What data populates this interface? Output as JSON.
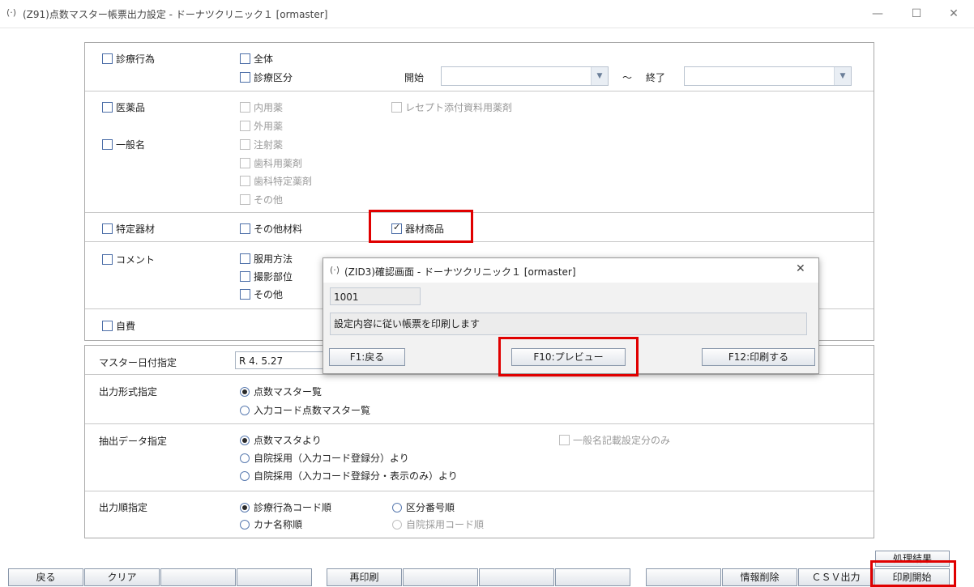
{
  "window": {
    "title": "(Z91)点数マスター帳票出力設定 - ドーナツクリニック１ [ormaster]",
    "app_icon": "orca-icon",
    "minimize": "—",
    "maximize": "☐",
    "close": "✕"
  },
  "section_shinryo": {
    "main": "診療行為",
    "all": "全体",
    "kubun": "診療区分",
    "start_label": "開始",
    "tilde": "～",
    "end_label": "終了",
    "start_value": "",
    "end_value": ""
  },
  "section_drug": {
    "main": "医薬品",
    "generic": "一般名",
    "items": [
      "内用薬",
      "外用薬",
      "注射薬",
      "歯科用薬剤",
      "歯科特定薬剤",
      "その他"
    ],
    "receipt": "レセプト添付資料用薬剤"
  },
  "section_material": {
    "main": "特定器材",
    "other": "その他材料",
    "product": "器材商品",
    "product_checked": true
  },
  "section_comment": {
    "main": "コメント",
    "items": [
      "服用方法",
      "撮影部位",
      "その他"
    ]
  },
  "section_self": {
    "main": "自費"
  },
  "master_date": {
    "label": "マスター日付指定",
    "value": "R 4. 5.27"
  },
  "output_format": {
    "label": "出力形式指定",
    "options": [
      "点数マスター覧",
      "入力コード点数マスター覧"
    ],
    "selected": 0
  },
  "extract": {
    "label": "抽出データ指定",
    "options": [
      "点数マスタより",
      "自院採用（入力コード登録分）より",
      "自院採用（入力コード登録分・表示のみ）より"
    ],
    "selected": 0,
    "generic_only": "一般名記載設定分のみ"
  },
  "order": {
    "label": "出力順指定",
    "options": [
      "診療行為コード順",
      "カナ名称順",
      "区分番号順",
      "自院採用コード順"
    ],
    "selected": 0
  },
  "dialog": {
    "title": "(ZID3)確認画面 - ドーナツクリニック１ [ormaster]",
    "close": "✕",
    "code": "1001",
    "message": "設定内容に従い帳票を印刷します",
    "f1": "F1:戻る",
    "f10": "F10:プレビュー",
    "f12": "F12:印刷する"
  },
  "result_button": "処理結果",
  "fkeys": [
    "戻る",
    "クリア",
    "",
    "",
    "再印刷",
    "",
    "",
    "",
    "",
    "情報削除",
    "ＣＳＶ出力",
    "印刷開始"
  ]
}
